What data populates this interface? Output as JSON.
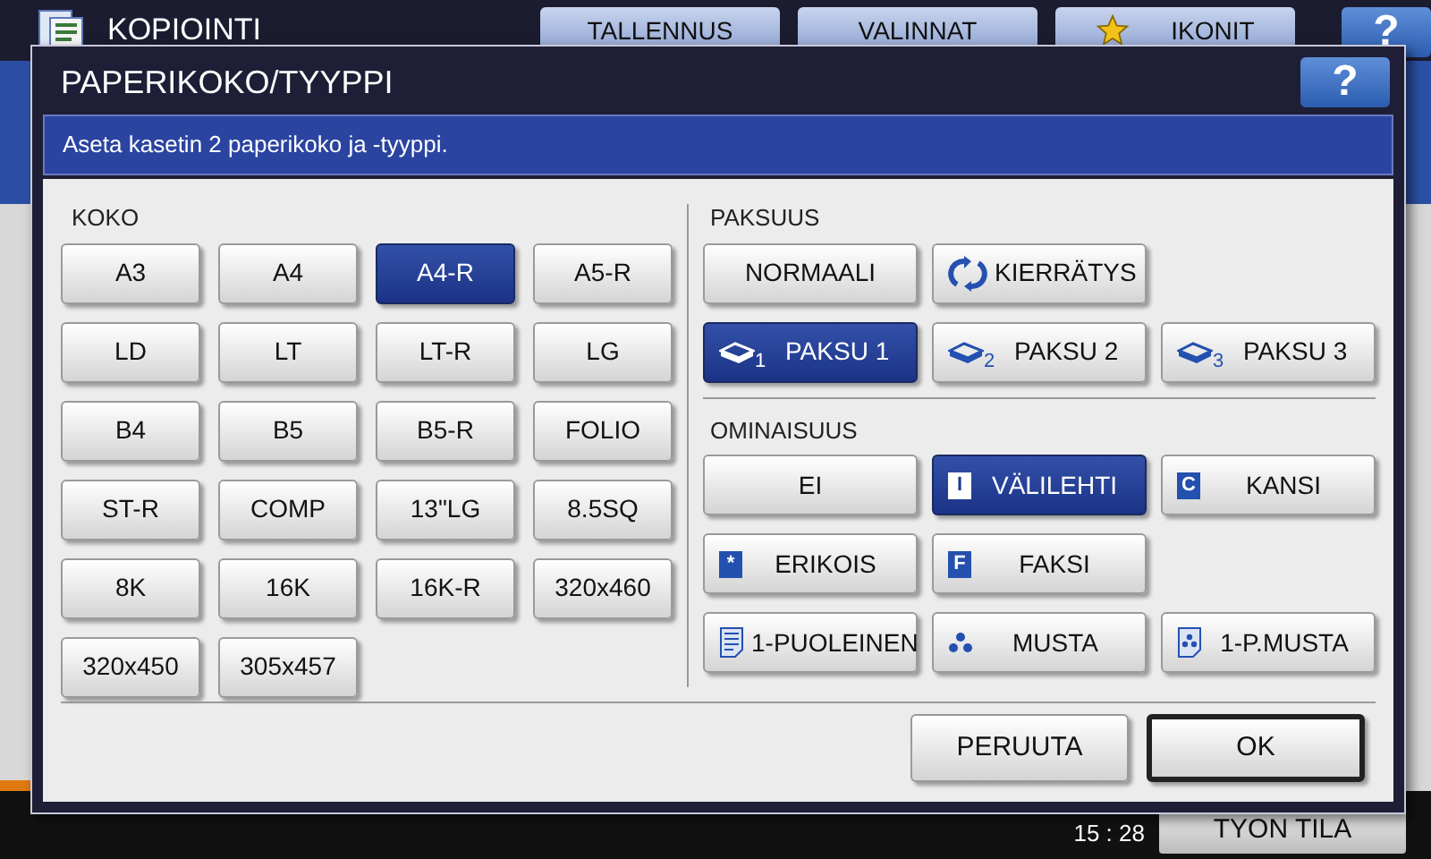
{
  "app": {
    "title": "KOPIOINTI",
    "tabs": [
      {
        "label": "TALLENNUS",
        "kind": "plain"
      },
      {
        "label": "VALINNAT",
        "kind": "plain"
      },
      {
        "label": "IKONIT",
        "kind": "star"
      }
    ],
    "help": "?",
    "time": "15 : 28",
    "job_status": "TYON TILA"
  },
  "dialog": {
    "title": "PAPERIKOKO/TYYPPI",
    "help": "?",
    "message": "Aseta kasetin 2 paperikoko ja -tyyppi.",
    "size": {
      "heading": "KOKO",
      "options": [
        {
          "label": "A3",
          "selected": false
        },
        {
          "label": "A4",
          "selected": false
        },
        {
          "label": "A4-R",
          "selected": true
        },
        {
          "label": "A5-R",
          "selected": false
        },
        {
          "label": "LD",
          "selected": false
        },
        {
          "label": "LT",
          "selected": false
        },
        {
          "label": "LT-R",
          "selected": false
        },
        {
          "label": "LG",
          "selected": false
        },
        {
          "label": "B4",
          "selected": false
        },
        {
          "label": "B5",
          "selected": false
        },
        {
          "label": "B5-R",
          "selected": false
        },
        {
          "label": "FOLIO",
          "selected": false
        },
        {
          "label": "ST-R",
          "selected": false
        },
        {
          "label": "COMP",
          "selected": false
        },
        {
          "label": "13\"LG",
          "selected": false
        },
        {
          "label": "8.5SQ",
          "selected": false
        },
        {
          "label": "8K",
          "selected": false
        },
        {
          "label": "16K",
          "selected": false
        },
        {
          "label": "16K-R",
          "selected": false
        },
        {
          "label": "320x460",
          "selected": false
        },
        {
          "label": "320x450",
          "selected": false
        },
        {
          "label": "305x457",
          "selected": false
        }
      ]
    },
    "thickness": {
      "heading": "PAKSUUS",
      "rows": [
        [
          {
            "label": "NORMAALI",
            "kind": "none",
            "selected": false
          },
          {
            "label": "KIERRÄTYS",
            "kind": "recycle",
            "selected": false
          }
        ],
        [
          {
            "label": "PAKSU 1",
            "kind": "stack",
            "badge": "1",
            "selected": true
          },
          {
            "label": "PAKSU 2",
            "kind": "stack",
            "badge": "2",
            "selected": false
          },
          {
            "label": "PAKSU 3",
            "kind": "stack",
            "badge": "3",
            "selected": false
          }
        ]
      ]
    },
    "attribute": {
      "heading": "OMINAISUUS",
      "rows": [
        [
          {
            "label": "EI",
            "kind": "none",
            "selected": false
          },
          {
            "label": "VÄLILEHTI",
            "kind": "letter",
            "icon_text": "I",
            "selected": true
          },
          {
            "label": "KANSI",
            "kind": "letter",
            "icon_text": "C",
            "selected": false
          }
        ],
        [
          {
            "label": "ERIKOIS",
            "kind": "letter",
            "icon_text": "*",
            "selected": false
          },
          {
            "label": "FAKSI",
            "kind": "letter",
            "icon_text": "F",
            "selected": false
          }
        ],
        [
          {
            "label": "1-PUOLEINEN",
            "kind": "page",
            "selected": false
          },
          {
            "label": "MUSTA",
            "kind": "dots",
            "selected": false
          },
          {
            "label": "1-P.MUSTA",
            "kind": "page-dots",
            "selected": false
          }
        ]
      ]
    },
    "buttons": [
      {
        "label": "PERUUTA",
        "default": false
      },
      {
        "label": "OK",
        "default": true
      }
    ]
  }
}
